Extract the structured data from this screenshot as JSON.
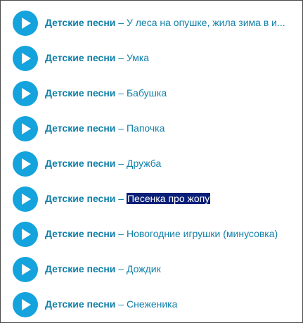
{
  "playlist": {
    "tracks": [
      {
        "artist": "Детские песни",
        "separator": "–",
        "title": "У леса на опушке, жила зима в и...",
        "play_icon": "play-icon",
        "selected": false
      },
      {
        "artist": "Детские песни",
        "separator": "–",
        "title": "Умка",
        "play_icon": "play-icon",
        "selected": false
      },
      {
        "artist": "Детские песни",
        "separator": "–",
        "title": "Бабушка",
        "play_icon": "play-icon",
        "selected": false
      },
      {
        "artist": "Детские песни",
        "separator": "–",
        "title": "Папочка",
        "play_icon": "play-icon",
        "selected": false
      },
      {
        "artist": "Детские песни",
        "separator": "–",
        "title": "Дружба",
        "play_icon": "play-icon",
        "selected": false
      },
      {
        "artist": "Детские песни",
        "separator": "–",
        "title": "Песенка про жопу",
        "play_icon": "play-icon",
        "selected": true
      },
      {
        "artist": "Детские песни",
        "separator": "–",
        "title": "Новогодние игрушки (минусовка)",
        "play_icon": "play-icon",
        "selected": false
      },
      {
        "artist": "Детские песни",
        "separator": "–",
        "title": "Дождик",
        "play_icon": "play-icon",
        "selected": false
      },
      {
        "artist": "Детские песни",
        "separator": "–",
        "title": "Снеженика",
        "play_icon": "play-icon",
        "selected": false
      }
    ]
  },
  "colors": {
    "play_button": "#14a3dc",
    "link_text": "#0f7fa8",
    "selection_bg": "#0a1f78",
    "selection_text": "#ffffff",
    "border": "#4a4a4a"
  }
}
